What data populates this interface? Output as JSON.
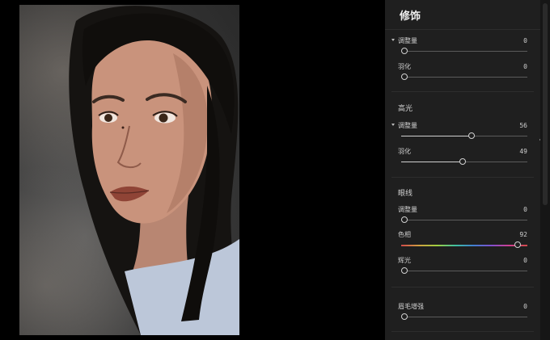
{
  "panel": {
    "title": "修饰",
    "sections": [
      {
        "heading": "",
        "sliders": [
          {
            "label": "调整量",
            "value": 0,
            "fraction": 0.0,
            "expanded": true
          },
          {
            "label": "羽化",
            "value": 0,
            "fraction": 0.0
          }
        ]
      },
      {
        "heading": "高光",
        "sliders": [
          {
            "label": "调整量",
            "value": 56,
            "fraction": 0.56,
            "expanded": true
          },
          {
            "label": "羽化",
            "value": 49,
            "fraction": 0.49
          }
        ]
      },
      {
        "heading": "眼线",
        "sliders": [
          {
            "label": "调整量",
            "value": 0,
            "fraction": 0.0
          },
          {
            "label": "色相",
            "value": 92,
            "fraction": 0.92,
            "hue": true
          },
          {
            "label": "辉光",
            "value": 0,
            "fraction": 0.0
          }
        ]
      },
      {
        "heading": "",
        "sliders": [
          {
            "label": "眉毛增强",
            "value": 0,
            "fraction": 0.0
          }
        ]
      }
    ]
  },
  "colors": {
    "panel_bg": "#1f1f1f",
    "canvas_bg": "#000000",
    "text": "#d8d8d8"
  }
}
